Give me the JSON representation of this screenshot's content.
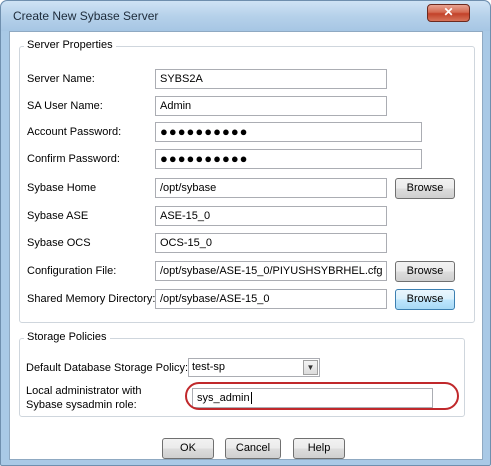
{
  "window": {
    "title": "Create New Sybase Server",
    "close_glyph": "✕"
  },
  "server_properties": {
    "legend": "Server Properties",
    "server_name": {
      "label": "Server Name:",
      "value": "SYBS2A"
    },
    "sa_user_name": {
      "label": "SA User Name:",
      "value": "Admin"
    },
    "account_password": {
      "label": "Account Password:",
      "value": "●●●●●●●●●●"
    },
    "confirm_password": {
      "label": "Confirm Password:",
      "value": "●●●●●●●●●●"
    },
    "sybase_home": {
      "label": "Sybase Home",
      "value": "/opt/sybase",
      "button": "Browse"
    },
    "sybase_ase": {
      "label": "Sybase ASE",
      "value": "ASE-15_0"
    },
    "sybase_ocs": {
      "label": "Sybase OCS",
      "value": "OCS-15_0"
    },
    "configuration_file": {
      "label": "Configuration File:",
      "value": "/opt/sybase/ASE-15_0/PIYUSHSYBRHEL.cfg",
      "button": "Browse"
    },
    "shared_memory_directory": {
      "label": "Shared Memory Directory:",
      "value": "/opt/sybase/ASE-15_0",
      "button": "Browse"
    }
  },
  "storage_policies": {
    "legend": "Storage Policies",
    "default_policy": {
      "label": "Default Database Storage Policy:",
      "value": "test-sp",
      "arrow": "▼"
    },
    "local_admin": {
      "label_line1": "Local administrator with",
      "label_line2": "Sybase sysadmin role:",
      "value": "sys_admin"
    }
  },
  "buttons": {
    "ok": "OK",
    "cancel": "Cancel",
    "help": "Help"
  },
  "colors": {
    "highlight_ring": "#c0282b",
    "close_button": "#c2422a",
    "focus_button": "#3c7fb1"
  }
}
